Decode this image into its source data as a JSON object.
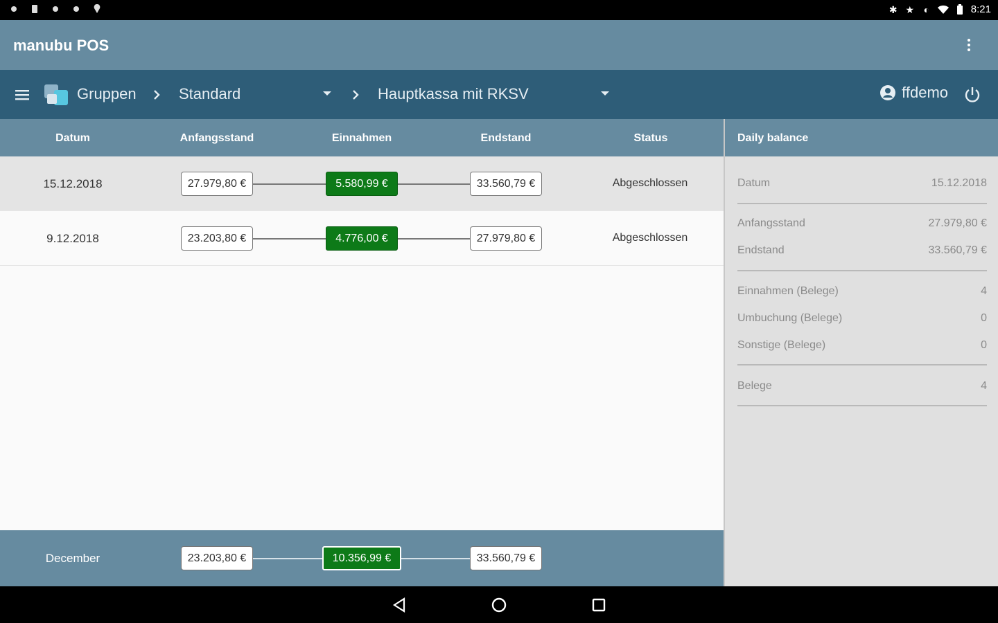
{
  "statusbar": {
    "time": "8:21",
    "left_icons": [
      "notification-icon",
      "sim-icon",
      "notification-icon",
      "notification-icon",
      "location-icon"
    ],
    "right_icons": [
      "bluetooth-icon",
      "star-icon",
      "vibrate-icon",
      "wifi-icon",
      "battery-icon"
    ]
  },
  "app": {
    "title": "manubu POS"
  },
  "toolbar": {
    "group_label": "Gruppen",
    "group_value": "Standard",
    "register_value": "Hauptkassa mit RKSV",
    "user": "ffdemo"
  },
  "table": {
    "headers": {
      "date": "Datum",
      "start": "Anfangsstand",
      "income": "Einnahmen",
      "end": "Endstand",
      "status": "Status"
    },
    "rows": [
      {
        "date": "15.12.2018",
        "start": "27.979,80 €",
        "income": "5.580,99 €",
        "end": "33.560,79 €",
        "status": "Abgeschlossen",
        "selected": true
      },
      {
        "date": "9.12.2018",
        "start": "23.203,80 €",
        "income": "4.776,00 €",
        "end": "27.979,80 €",
        "status": "Abgeschlossen",
        "selected": false
      }
    ],
    "summary": {
      "label": "December",
      "start": "23.203,80 €",
      "income": "10.356,99 €",
      "end": "33.560,79 €"
    }
  },
  "side": {
    "title": "Daily balance",
    "date_label": "Datum",
    "date_value": "15.12.2018",
    "start_label": "Anfangsstand",
    "start_value": "27.979,80 €",
    "end_label": "Endstand",
    "end_value": "33.560,79 €",
    "income_label": "Einnahmen (Belege)",
    "income_value": "4",
    "transfer_label": "Umbuchung (Belege)",
    "transfer_value": "0",
    "other_label": "Sonstige (Belege)",
    "other_value": "0",
    "receipts_label": "Belege",
    "receipts_value": "4"
  },
  "colors": {
    "appbar": "#668ba0",
    "toolbar": "#2e5d78",
    "income_green": "#0d7a18"
  }
}
